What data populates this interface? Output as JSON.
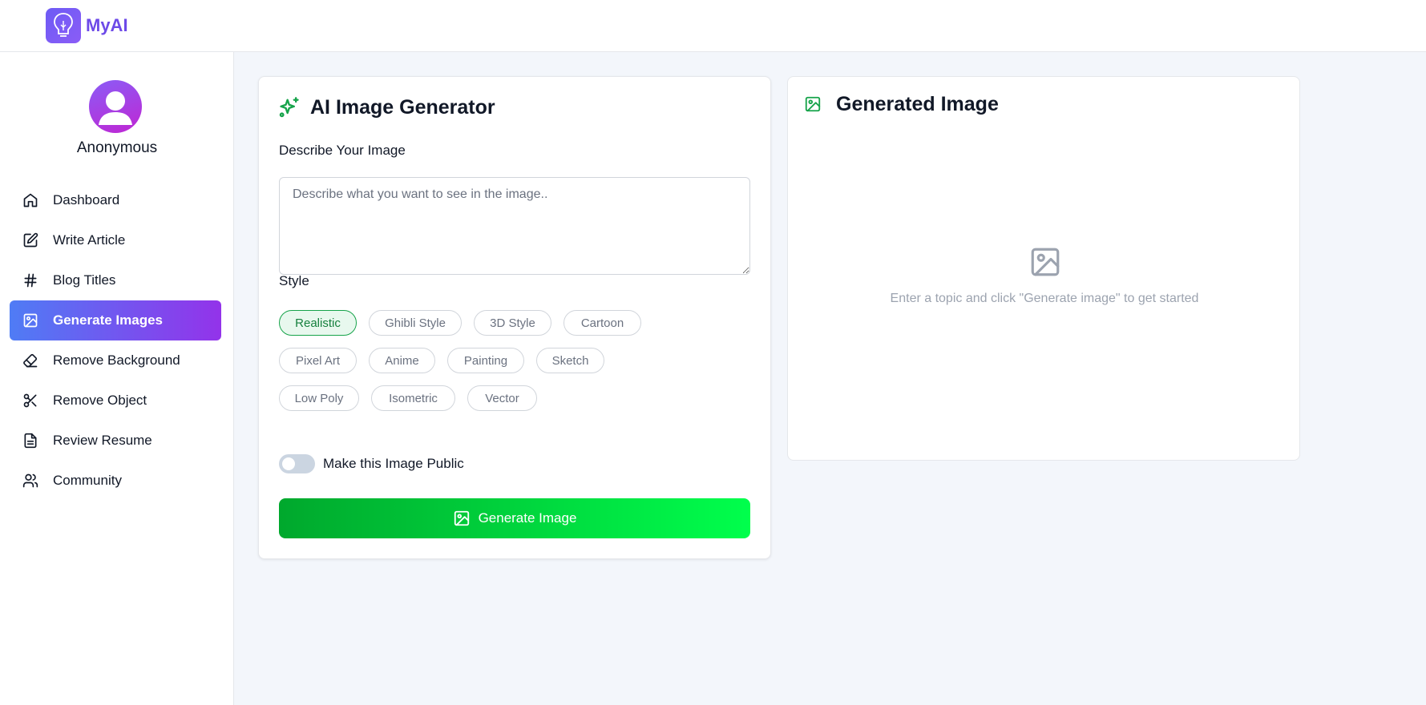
{
  "header": {
    "app_name": "MyAI",
    "logo_icon": "lightbulb-icon",
    "brand_color": "#6d4ae8"
  },
  "sidebar": {
    "user_name": "Anonymous",
    "items": [
      {
        "label": "Dashboard",
        "icon": "home-icon",
        "active": false
      },
      {
        "label": "Write Article",
        "icon": "edit-icon",
        "active": false
      },
      {
        "label": "Blog Titles",
        "icon": "hash-icon",
        "active": false
      },
      {
        "label": "Generate Images",
        "icon": "image-icon",
        "active": true
      },
      {
        "label": "Remove Background",
        "icon": "eraser-icon",
        "active": false
      },
      {
        "label": "Remove Object",
        "icon": "scissors-icon",
        "active": false
      },
      {
        "label": "Review Resume",
        "icon": "file-text-icon",
        "active": false
      },
      {
        "label": "Community",
        "icon": "users-icon",
        "active": false
      }
    ]
  },
  "generator": {
    "title": "AI Image Generator",
    "title_icon": "sparkles-icon",
    "prompt_label": "Describe Your Image",
    "prompt_value": "",
    "prompt_placeholder": "Describe what you want to see in the image..",
    "style_label": "Style",
    "styles": [
      {
        "label": "Realistic",
        "selected": true
      },
      {
        "label": "Ghibli Style",
        "selected": false
      },
      {
        "label": "3D Style",
        "selected": false
      },
      {
        "label": "Cartoon",
        "selected": false
      },
      {
        "label": "Pixel Art",
        "selected": false
      },
      {
        "label": "Anime",
        "selected": false
      },
      {
        "label": "Painting",
        "selected": false
      },
      {
        "label": "Sketch",
        "selected": false
      },
      {
        "label": "Low Poly",
        "selected": false
      },
      {
        "label": "Isometric",
        "selected": false
      },
      {
        "label": "Vector",
        "selected": false
      }
    ],
    "public_toggle_label": "Make this Image Public",
    "public_toggle_on": false,
    "generate_button_label": "Generate Image",
    "accent_color": "#00a82d"
  },
  "result": {
    "title": "Generated Image",
    "title_icon": "image-icon",
    "empty_icon": "image-icon",
    "empty_message": "Enter a topic and click \"Generate image\" to get started"
  }
}
